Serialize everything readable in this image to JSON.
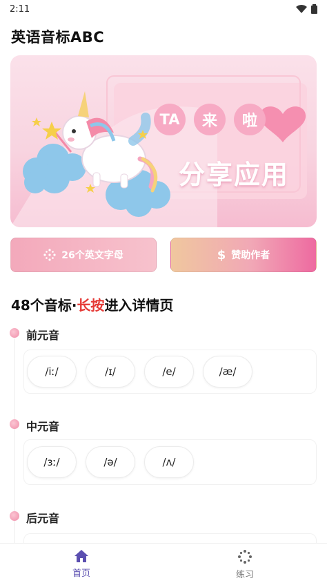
{
  "status_bar": {
    "time": "2:11"
  },
  "app": {
    "title": "英语音标ABC"
  },
  "banner": {
    "bubble_ta": "TA",
    "bubble_lai": "来",
    "bubble_la": "啦",
    "share_text": "分享应用"
  },
  "actions": {
    "letters_label": "26个英文字母",
    "sponsor_label": "赞助作者"
  },
  "section": {
    "prefix": "48个音标·",
    "highlight": "长按",
    "suffix": "进入详情页",
    "highlight_color": "#e53935"
  },
  "groups": [
    {
      "title": "前元音",
      "symbols": [
        "/iː/",
        "/ɪ/",
        "/e/",
        "/æ/"
      ]
    },
    {
      "title": "中元音",
      "symbols": [
        "/ɜː/",
        "/ə/",
        "/ʌ/"
      ]
    },
    {
      "title": "后元音",
      "symbols": []
    }
  ],
  "nav": {
    "home_label": "首页",
    "practice_label": "练习",
    "active_color": "#5b4fb0"
  }
}
